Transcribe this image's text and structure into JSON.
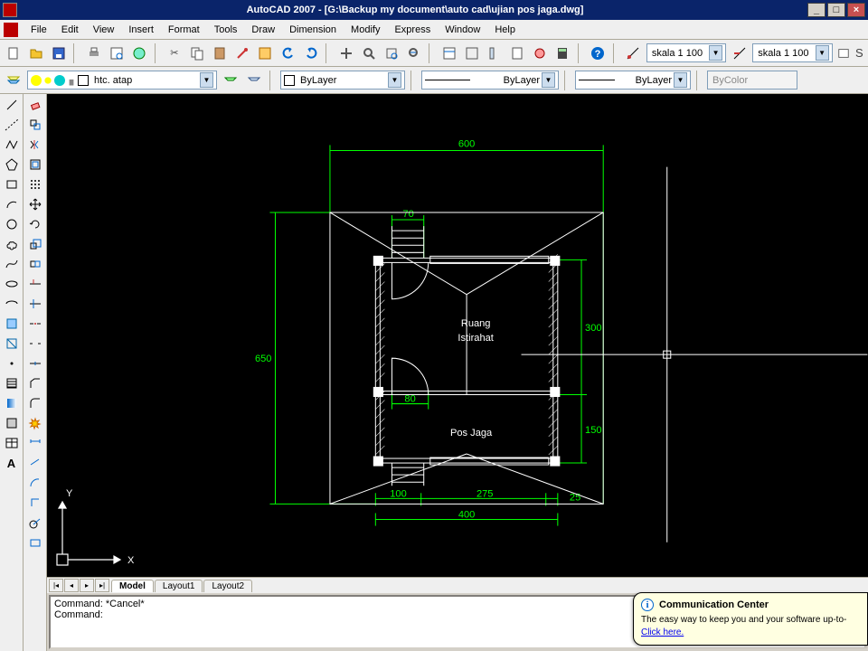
{
  "titlebar": {
    "title": "AutoCAD 2007 - [G:\\Backup my document\\auto cad\\ujian pos jaga.dwg]"
  },
  "menu": {
    "items": [
      "File",
      "Edit",
      "View",
      "Insert",
      "Format",
      "Tools",
      "Draw",
      "Dimension",
      "Modify",
      "Express",
      "Window",
      "Help"
    ]
  },
  "standard_toolbar": {
    "scale1": "skala 1 100",
    "scale2": "skala 1 100"
  },
  "layer_row": {
    "current_layer": "htc. atap",
    "plot_style": "ByColor"
  },
  "props_row": {
    "color": "ByLayer",
    "linetype": "ByLayer",
    "lineweight": "ByLayer"
  },
  "drawing": {
    "dim_600": "600",
    "dim_70": "70",
    "dim_300": "300",
    "dim_650": "650",
    "dim_80": "80",
    "dim_150": "150",
    "dim_100": "100",
    "dim_275": "275",
    "dim_25": "25",
    "dim_400": "400",
    "text_ruang": "Ruang",
    "text_istirahat": "Istirahat",
    "text_posjaga": "Pos Jaga",
    "ucs_x": "X",
    "ucs_y": "Y"
  },
  "tabs": {
    "t0": "Model",
    "t1": "Layout1",
    "t2": "Layout2"
  },
  "command": {
    "line1": "Command: *Cancel*",
    "line2": "Command:"
  },
  "comm_center": {
    "title": "Communication Center",
    "body": "The easy way to keep you and your software up-to-",
    "link": "Click here."
  }
}
